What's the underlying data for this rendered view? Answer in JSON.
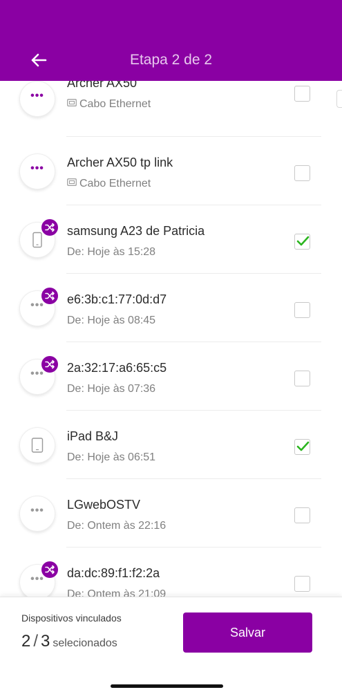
{
  "header": {
    "title": "Etapa 2 de 2",
    "back_icon": "arrow-left-icon",
    "color": "#8a00a3"
  },
  "devices": [
    {
      "name": "Archer AX50",
      "subtitle": "Cabo Ethernet",
      "icon": "more-dots-icon",
      "connection_icon": "ethernet-icon",
      "badge": false,
      "checked": false
    },
    {
      "name": "Archer AX50 tp link",
      "subtitle": "Cabo Ethernet",
      "icon": "more-dots-icon",
      "connection_icon": "ethernet-icon",
      "badge": false,
      "checked": false
    },
    {
      "name": "samsung A23 de Patricia",
      "subtitle": "De: Hoje às 15:28",
      "icon": "smartphone-icon",
      "badge": true,
      "checked": true
    },
    {
      "name": "e6:3b:c1:77:0d:d7",
      "subtitle": "De: Hoje às 08:45",
      "icon": "more-dots-icon",
      "badge": true,
      "checked": false
    },
    {
      "name": "2a:32:17:a6:65:c5",
      "subtitle": "De: Hoje às 07:36",
      "icon": "more-dots-icon",
      "badge": true,
      "checked": false
    },
    {
      "name": "iPad B&J",
      "subtitle": "De: Hoje às 06:51",
      "icon": "tablet-icon",
      "badge": false,
      "checked": true
    },
    {
      "name": "LGwebOSTV",
      "subtitle": "De: Ontem às 22:16",
      "icon": "more-dots-icon",
      "badge": false,
      "checked": false
    },
    {
      "name": "da:dc:89:f1:f2:2a",
      "subtitle": "De: Ontem às 21:09",
      "icon": "more-dots-icon",
      "badge": true,
      "checked": false
    }
  ],
  "footer": {
    "label": "Dispositivos vinculados",
    "selected": "2",
    "separator": "/",
    "total": "3",
    "selected_suffix": "selecionados",
    "save_label": "Salvar"
  },
  "colors": {
    "accent": "#8a00a3",
    "check": "#2bb51f"
  }
}
